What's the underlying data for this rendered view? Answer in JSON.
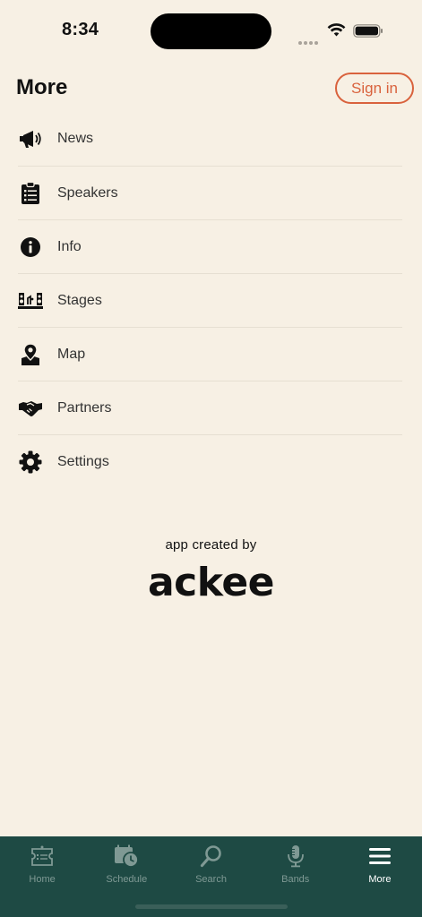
{
  "status_bar": {
    "time": "8:34"
  },
  "header": {
    "title": "More",
    "sign_in_label": "Sign in"
  },
  "menu": {
    "items": [
      {
        "label": "News",
        "icon": "megaphone-icon"
      },
      {
        "label": "Speakers",
        "icon": "clipboard-list-icon"
      },
      {
        "label": "Info",
        "icon": "info-circle-icon"
      },
      {
        "label": "Stages",
        "icon": "stage-icon"
      },
      {
        "label": "Map",
        "icon": "map-pin-icon"
      },
      {
        "label": "Partners",
        "icon": "handshake-icon"
      },
      {
        "label": "Settings",
        "icon": "gear-icon"
      }
    ]
  },
  "credit": {
    "text": "app created by",
    "logo": "ackee"
  },
  "tab_bar": {
    "tabs": [
      {
        "label": "Home",
        "icon": "ticket-icon",
        "active": false
      },
      {
        "label": "Schedule",
        "icon": "calendar-clock-icon",
        "active": false
      },
      {
        "label": "Search",
        "icon": "search-icon",
        "active": false
      },
      {
        "label": "Bands",
        "icon": "microphone-icon",
        "active": false
      },
      {
        "label": "More",
        "icon": "menu-icon",
        "active": true
      }
    ]
  },
  "colors": {
    "background": "#f7f0e4",
    "accent": "#d9623d",
    "tab_bar": "#1e4a44",
    "tab_inactive": "#7f9994",
    "tab_active": "#ffffff"
  }
}
